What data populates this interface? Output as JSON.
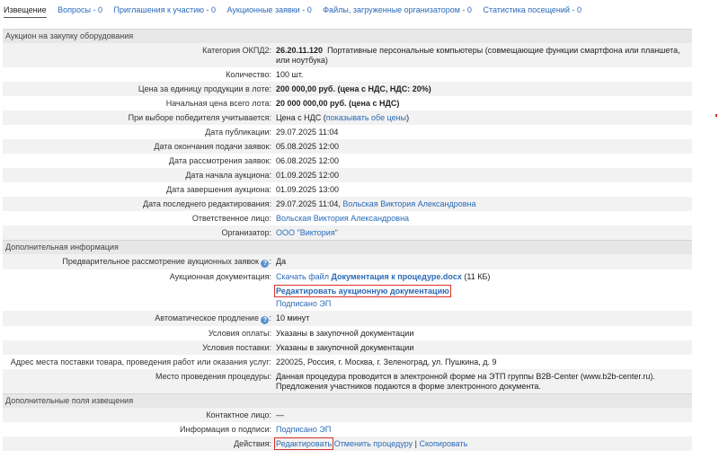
{
  "tabs": [
    {
      "label": "Извещение",
      "active": true
    },
    {
      "label": "Вопросы - 0"
    },
    {
      "label": "Приглашения к участию - 0"
    },
    {
      "label": "Аукционные заявки - 0"
    },
    {
      "label": "Файлы, загруженные организатором - 0"
    },
    {
      "label": "Статистика посещений - 0"
    }
  ],
  "section1": {
    "title": "Аукцион на закупку оборудования",
    "okpd_label": "Категория ОКПД2:",
    "okpd_code": "26.20.11.120",
    "okpd_text": "Портативные персональные компьютеры (совмещающие функции смартфона или планшета, или ноутбука)",
    "qty_label": "Количество:",
    "qty_value": "100 шт.",
    "unit_price_label": "Цена за единицу продукции в лоте:",
    "unit_price_value": "200 000,00 руб. (цена с НДС, НДС: 20%)",
    "start_price_label": "Начальная цена всего лота:",
    "start_price_value": "20 000 000,00 руб. (цена с НДС)",
    "winner_label": "При выборе победителя учитывается:",
    "winner_value": "Цена с НДС (",
    "winner_link": "показывать обе цены",
    "winner_close": ")",
    "pub_label": "Дата публикации:",
    "pub_value": "29.07.2025 11:04",
    "deadline_label": "Дата окончания подачи заявок:",
    "deadline_value": "05.08.2025 12:00",
    "review_label": "Дата рассмотрения заявок:",
    "review_value": "06.08.2025 12:00",
    "auction_start_label": "Дата начала аукциона:",
    "auction_start_value": "01.09.2025 12:00",
    "auction_end_label": "Дата завершения аукциона:",
    "auction_end_value": "01.09.2025 13:00",
    "last_edit_label": "Дата последнего редактирования:",
    "last_edit_value": "29.07.2025 11:04,",
    "last_edit_person": "Вольская Виктория Александровна",
    "responsible_label": "Ответственное лицо:",
    "responsible_value": "Вольская Виктория Александровна",
    "organizer_label": "Организатор:",
    "organizer_value": "ООО \"Виктория\""
  },
  "section2": {
    "title": "Дополнительная информация",
    "prelim_label": "Предварительное рассмотрение аукционных заявок",
    "prelim_value": "Да",
    "docs_label": "Аукционная документация:",
    "docs_download": "Скачать файл",
    "docs_file": "Документация к процедуре.docx",
    "docs_size": "(11 КБ)",
    "docs_edit": "Редактировать аукционную документацию",
    "docs_signed": "Подписано ЭП",
    "auto_ext_label": "Автоматическое продление",
    "auto_ext_value": "10 минут",
    "payment_label": "Условия оплаты:",
    "payment_value": "Указаны в закупочной документации",
    "delivery_label": "Условия поставки:",
    "delivery_value": "Указаны в закупочной документации",
    "address_label": "Адрес места поставки товара, проведения работ или оказания услуг:",
    "address_value": "220025, Россия, г. Москва, г. Зеленоград, ул. Пушкина, д. 9",
    "place_label": "Место проведения процедуры:",
    "place_value_1": "Данная процедура проводится в электронной форме на ЭТП группы B2B-Center (www.b2b-center.ru).",
    "place_value_2": "Предложения участников подаются в форме электронного документа."
  },
  "section3": {
    "title": "Дополнительные поля извещения",
    "contact_label": "Контактное лицо:",
    "contact_value": "—",
    "sign_label": "Информация о подписи:",
    "sign_value": "Подписано ЭП",
    "actions_label": "Действия:",
    "action_edit": "Редактировать",
    "action_cancel": "Отменить процедуру",
    "action_sep": "|",
    "action_copy": "Скопировать"
  },
  "icons": {
    "help": "question-circle-icon"
  },
  "colors": {
    "link": "#2a6ab8",
    "highlight": "#d9302a",
    "section_bg": "#e7e7e7",
    "row_alt": "#f2f2f2"
  }
}
